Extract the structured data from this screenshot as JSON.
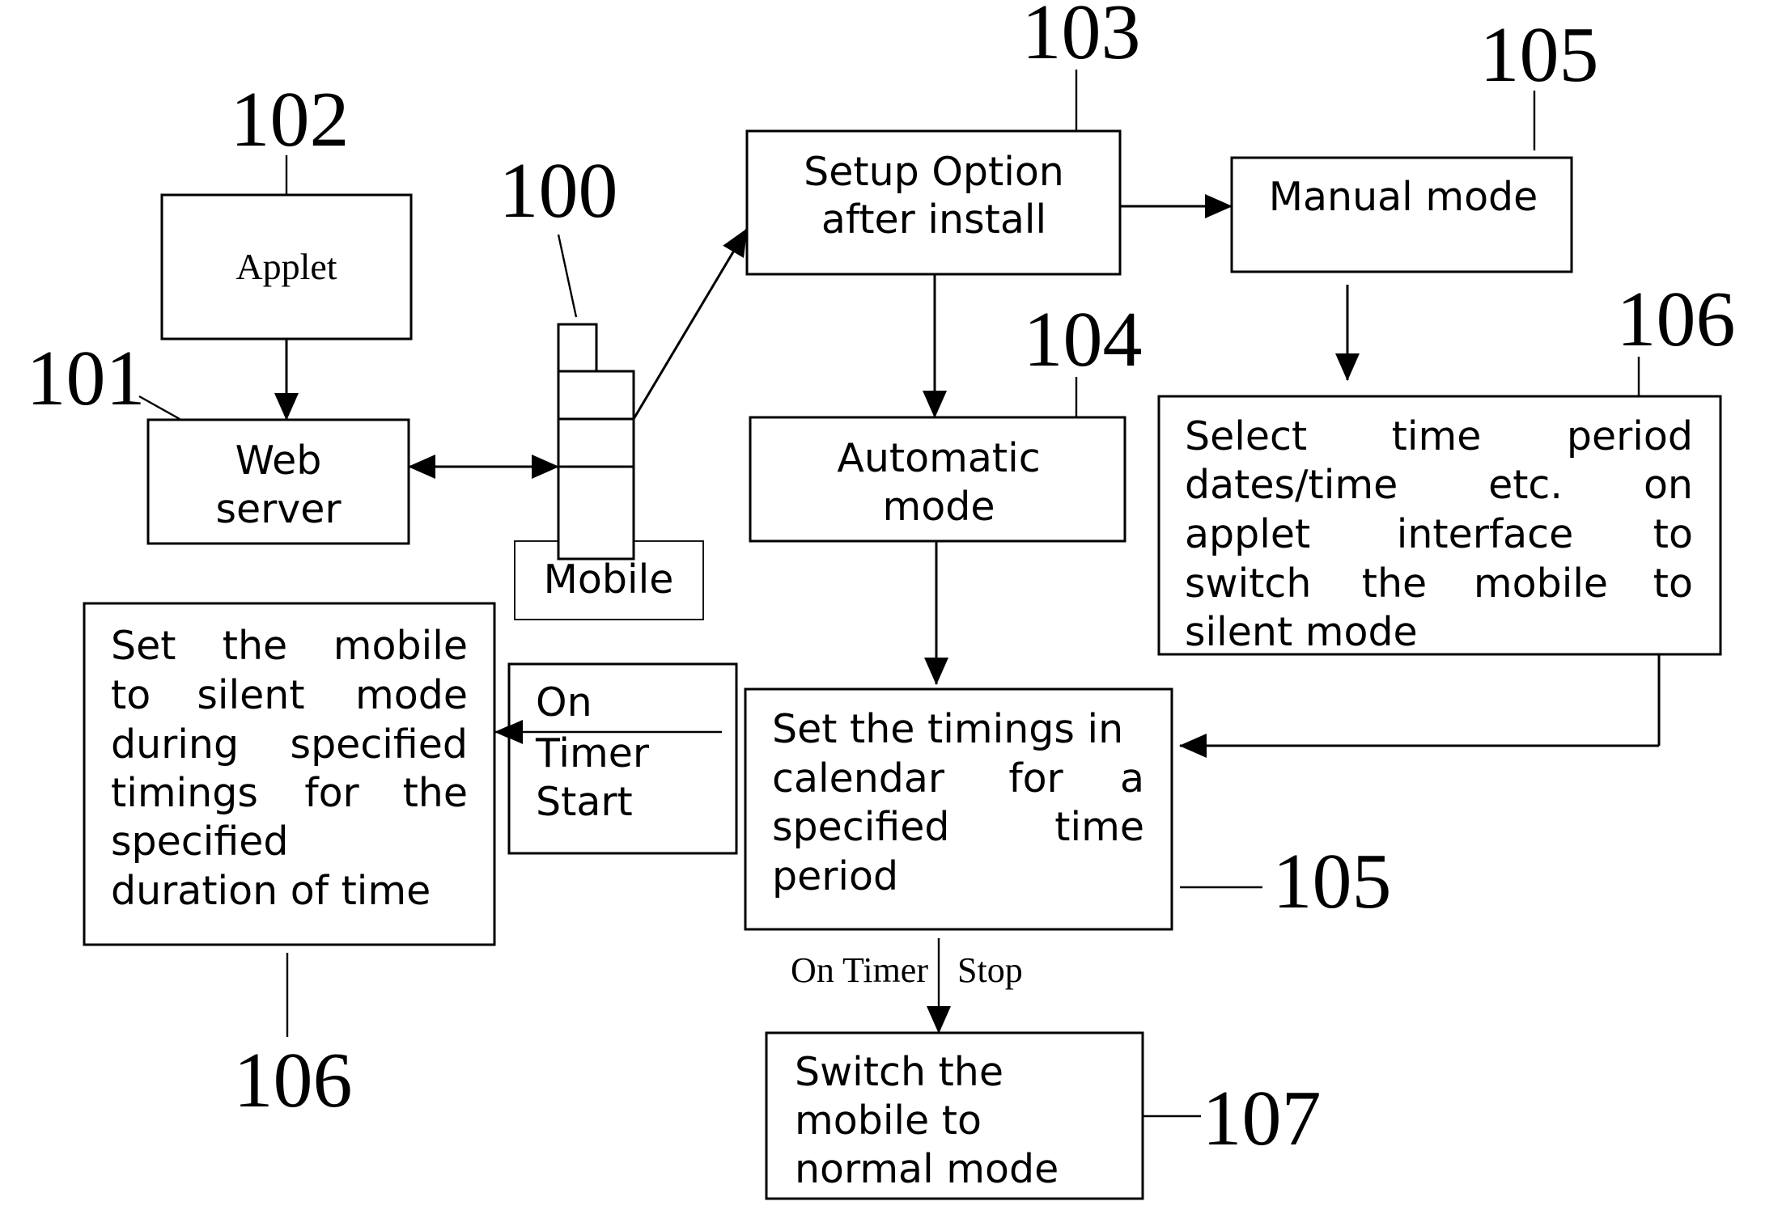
{
  "diagram": {
    "type": "flowchart",
    "nodes": {
      "applet": {
        "label": "Applet",
        "ref": "102"
      },
      "web_server": {
        "lines": [
          "Web",
          "server"
        ],
        "ref": "101"
      },
      "mobile": {
        "label": "Mobile",
        "ref": "100"
      },
      "setup": {
        "lines": [
          "Setup Option",
          "after install"
        ],
        "ref": "103"
      },
      "manual": {
        "label": "Manual mode",
        "ref": "105"
      },
      "automatic": {
        "lines": [
          "Automatic",
          "mode"
        ],
        "ref": "104"
      },
      "select": {
        "lines": [
          [
            "Select",
            "time",
            "period"
          ],
          [
            "dates/time",
            "etc.",
            "on"
          ],
          [
            "applet",
            "interface",
            "to"
          ],
          [
            "switch",
            "the",
            "mobile",
            "to"
          ],
          [
            "silent mode"
          ]
        ],
        "ref": "106"
      },
      "set_timings": {
        "lines": [
          [
            "Set the timings in"
          ],
          [
            "calendar",
            "for",
            "a"
          ],
          [
            "specified",
            "time"
          ],
          [
            "period"
          ]
        ],
        "ref": "105"
      },
      "timer_start": {
        "lines": [
          "On",
          "Timer",
          "Start"
        ]
      },
      "silent": {
        "lines": [
          [
            "Set",
            "the",
            "mobile"
          ],
          [
            "to",
            "silent",
            "mode"
          ],
          [
            "during",
            "specified"
          ],
          [
            "timings",
            "for",
            "the"
          ],
          [
            "specified"
          ],
          [
            "duration of time"
          ]
        ],
        "ref": "106"
      },
      "switch_normal": {
        "lines": [
          "Switch the",
          "mobile to",
          "normal mode"
        ],
        "ref": "107"
      }
    },
    "edge_labels": {
      "timer_stop_left": "On Timer",
      "timer_stop_right": "Stop"
    },
    "edges": [
      {
        "from": "applet",
        "to": "web_server"
      },
      {
        "from": "web_server",
        "to": "mobile",
        "bidirectional": true
      },
      {
        "from": "mobile",
        "to": "setup"
      },
      {
        "from": "setup",
        "to": "manual"
      },
      {
        "from": "setup",
        "to": "automatic"
      },
      {
        "from": "manual",
        "to": "select"
      },
      {
        "from": "automatic",
        "to": "set_timings"
      },
      {
        "from": "select",
        "to": "set_timings"
      },
      {
        "from": "set_timings",
        "to": "silent",
        "label": "On Timer Start"
      },
      {
        "from": "set_timings",
        "to": "switch_normal",
        "label": "On Timer Stop"
      }
    ]
  }
}
